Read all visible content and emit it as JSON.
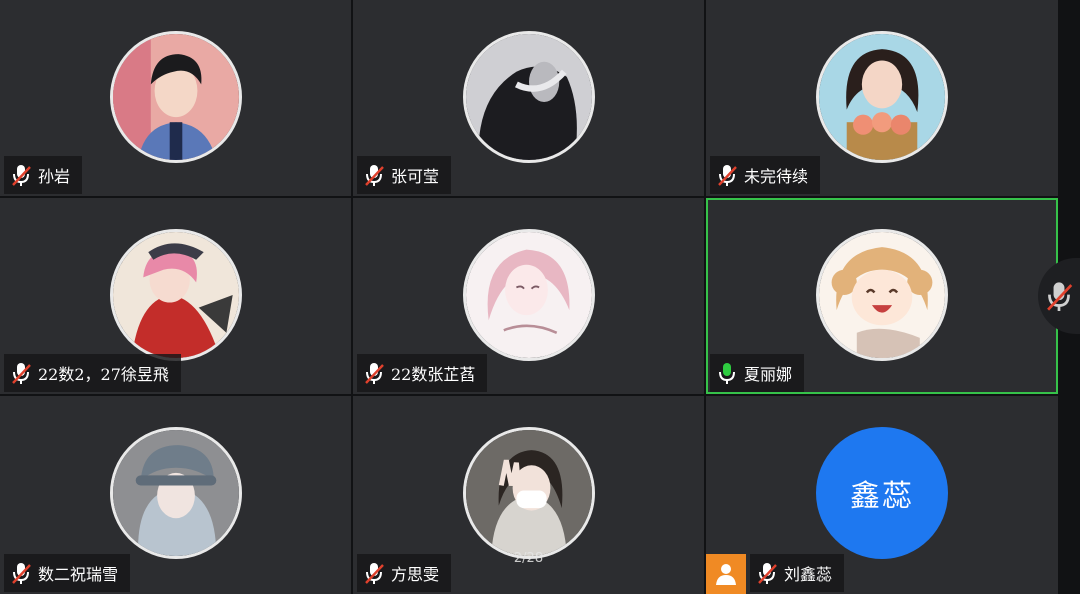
{
  "participants": [
    {
      "name": "孙岩",
      "mic": "muted",
      "avatar": "avatar-photo-boy-icon"
    },
    {
      "name": "张可莹",
      "mic": "muted",
      "avatar": "avatar-photo-dark-icon"
    },
    {
      "name": "未完待续",
      "mic": "muted",
      "avatar": "avatar-photo-girl-peaches-icon"
    },
    {
      "name": "22数2，27徐昱飛",
      "mic": "muted",
      "avatar": "avatar-anime-red-icon"
    },
    {
      "name": "22数张芷萏",
      "mic": "muted",
      "avatar": "avatar-sketch-pink-icon"
    },
    {
      "name": "夏丽娜",
      "mic": "active",
      "avatar": "avatar-anime-smile-icon"
    },
    {
      "name": "数二祝瑞雪",
      "mic": "muted",
      "avatar": "avatar-photo-grey-hat-icon"
    },
    {
      "name": "方思雯",
      "mic": "muted",
      "avatar": "avatar-photo-selfie-icon"
    },
    {
      "name": "刘鑫蕊",
      "mic": "muted",
      "avatar_text": "鑫蕊",
      "host": true
    }
  ],
  "page_indicator": "2/28",
  "colors": {
    "active_border": "#36c24a",
    "muted_mic": "#e0412d",
    "active_mic": "#2ecc40",
    "host_badge": "#f08a24",
    "initials_avatar": "#1e78f0"
  },
  "side_control": {
    "icon": "microphone-muted-icon"
  }
}
